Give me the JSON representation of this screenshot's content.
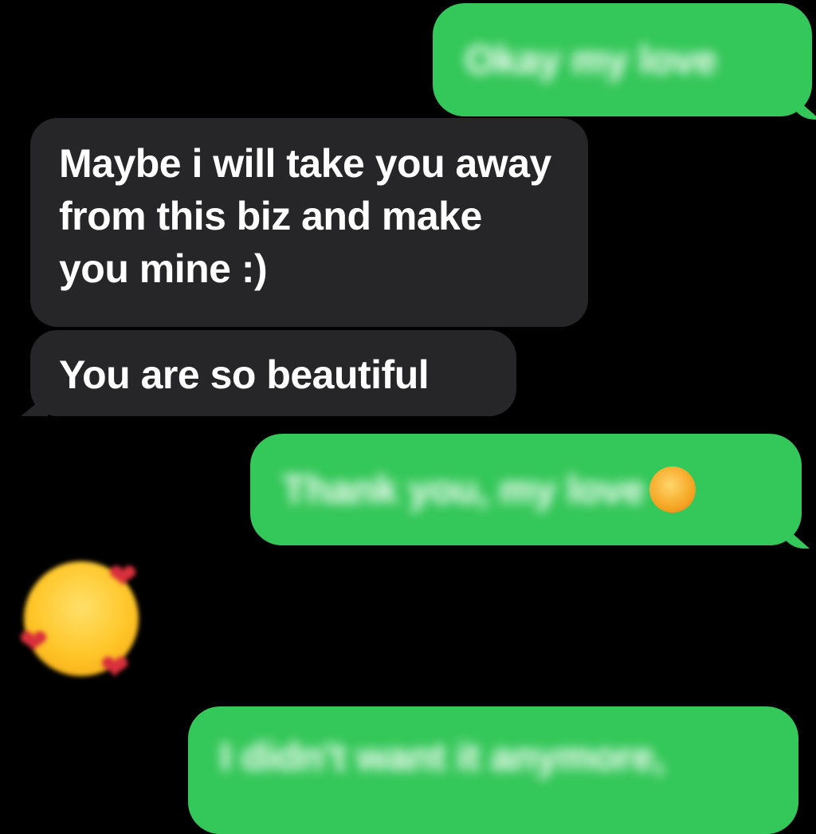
{
  "messages": {
    "sent_1": "Okay my love",
    "received_1": "Maybe i will take you away from this biz and make you mine :)",
    "received_2": "You are so beautiful",
    "sent_2": "Thank you, my love",
    "sent_3": "I didn't want it anymore,"
  },
  "icons": {
    "reaction_emoji": "smiling-face-with-hearts-icon",
    "inline_emoji": "blushing-face-icon"
  },
  "colors": {
    "sent_bubble": "#34c759",
    "received_bubble": "#262628",
    "background": "#000000",
    "text": "#ffffff"
  }
}
